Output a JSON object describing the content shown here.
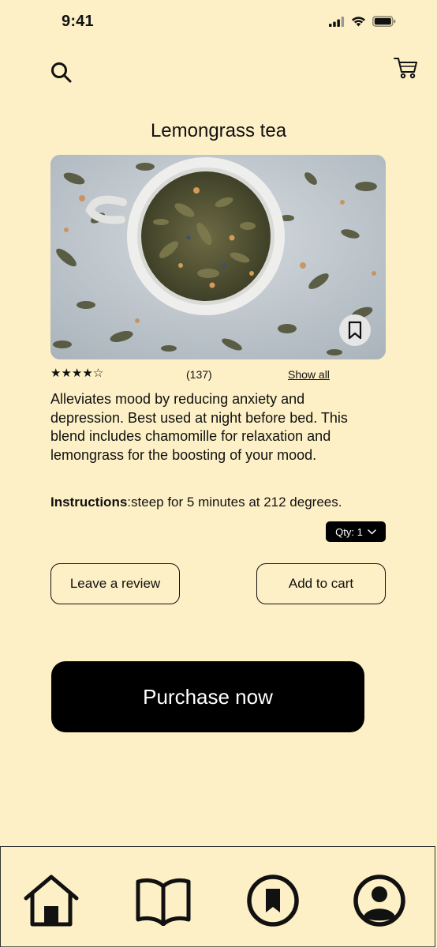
{
  "status_bar": {
    "time": "9:41"
  },
  "header": {
    "search_icon": "search-icon",
    "cart_icon": "cart-icon"
  },
  "product": {
    "title": "Lemongrass tea",
    "rating": 4.5,
    "stars": "★★★★☆",
    "review_count": "(137)",
    "show_all_label": "Show all",
    "description": "Alleviates mood by reducing anxiety and depression. Best used at night before bed. This blend includes chamomille for relaxation and lemongrass for the boosting of your mood.",
    "instructions_label": "Instructions",
    "instructions_text": ":steep for 5 minutes at 212 degrees.",
    "quantity_label": "Qty: 1"
  },
  "actions": {
    "leave_review": "Leave a review",
    "add_to_cart": "Add to cart",
    "purchase_now": "Purchase now"
  },
  "bottom_nav": [
    {
      "name": "home",
      "icon": "home-icon"
    },
    {
      "name": "library",
      "icon": "book-icon"
    },
    {
      "name": "saved",
      "icon": "bookmark-icon"
    },
    {
      "name": "profile",
      "icon": "profile-icon"
    }
  ],
  "colors": {
    "background": "#fdf0c6",
    "primary": "#000000",
    "text": "#111111"
  }
}
